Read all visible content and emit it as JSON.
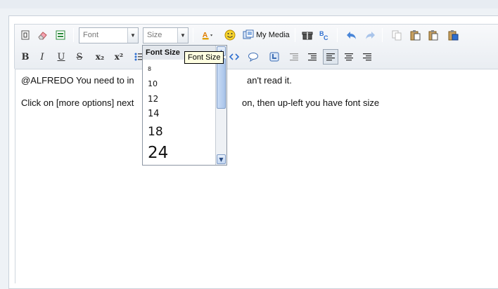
{
  "toolbar": {
    "font_combo": {
      "value": "Font"
    },
    "size_combo": {
      "value": "Size"
    },
    "my_media_label": "My Media",
    "row2": {
      "bold": "B",
      "italic": "I",
      "underline": "U",
      "strike": "S",
      "subscript": "x₂",
      "superscript": "x²"
    }
  },
  "size_dropdown": {
    "header": "Font Size",
    "items": [
      "8",
      "10",
      "12",
      "14",
      "18",
      "24"
    ]
  },
  "tooltip": "Font Size",
  "editor": {
    "line1_a": "@ALFREDO You need to in",
    "line1_b": "an't read it.",
    "line2_a": "Click on [more options] next",
    "line2_b": "on, then up-left you have font size"
  },
  "colors": {
    "accent_blue": "#2f6fcf",
    "tooltip_bg": "#ffffe1"
  }
}
